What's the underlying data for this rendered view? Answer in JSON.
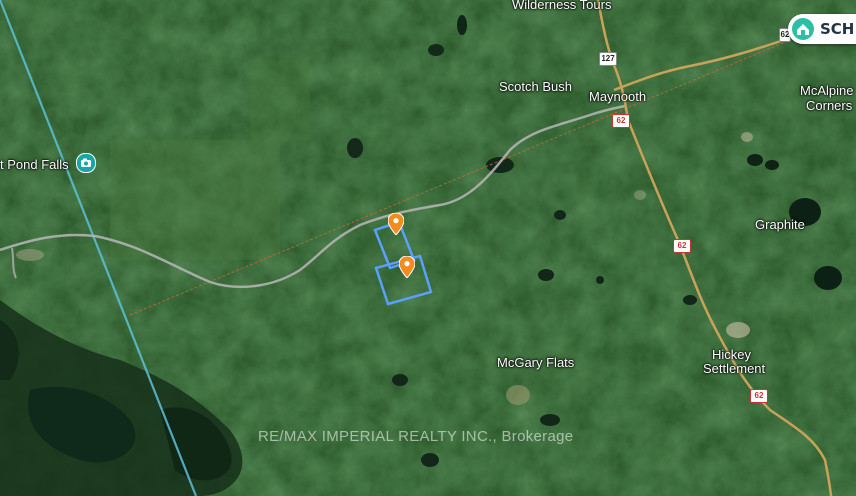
{
  "map": {
    "labels": {
      "wilderness_tours": "Wilderness Tours",
      "scotch_bush": "Scotch Bush",
      "maynooth": "Maynooth",
      "mcalpine_corners_1": "McAlpine",
      "mcalpine_corners_2": "Corners",
      "pond_falls": "t Pond Falls",
      "graphite": "Graphite",
      "mcgary_flats": "McGary Flats",
      "hickey_settlement_1": "Hickey",
      "hickey_settlement_2": "Settlement"
    },
    "shields": {
      "hwy127": "127",
      "hwy62_a": "62",
      "hwy62_b": "62",
      "hwy62_c": "62",
      "hwy_top": "62"
    },
    "watermark": "RE/MAX IMPERIAL REALTY INC., Brokerage",
    "badge_text": "SCH",
    "colors": {
      "forest": "#2d5a2a",
      "parcel_outline": "#5aa0ff",
      "pin": "#f28c1e",
      "road_major": "#c9a25a",
      "road_minor": "#b8b8b8",
      "boundary": "#4fb6d6"
    },
    "icons": {
      "poi": "tourist-attraction-icon",
      "pin": "location-pin-icon",
      "badge": "home-logo-icon"
    }
  }
}
